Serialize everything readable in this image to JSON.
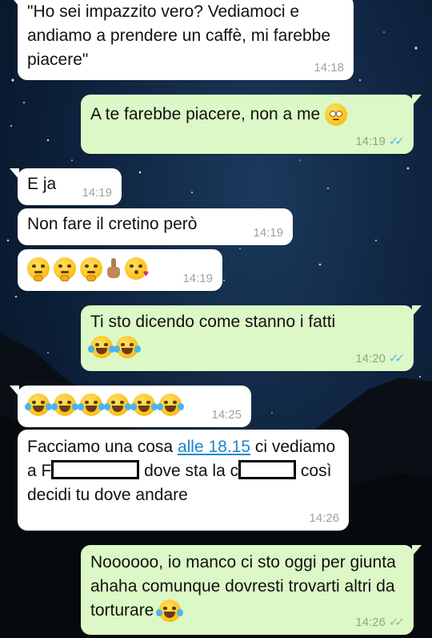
{
  "colors": {
    "incoming": "#ffffff",
    "outgoing": "#dcf8c6",
    "link": "#1a87c9",
    "read_ticks": "#4fb6ec"
  },
  "messages": [
    {
      "from": "them",
      "text": "\"Ho sei impazzito vero? Vediamoci e andiamo a prendere un caffè, mi farebbe piacere\"",
      "time": "14:18"
    },
    {
      "from": "me",
      "text": "A te farebbe piacere, non a me",
      "emoji": [
        "face-with-rolling-eyes"
      ],
      "time": "14:19",
      "status": "read"
    },
    {
      "from": "them",
      "text": "E ja",
      "time": "14:19"
    },
    {
      "from": "them",
      "text": "Non fare il cretino però",
      "time": "14:19"
    },
    {
      "from": "them",
      "emoji": [
        "thinking-face",
        "thinking-face",
        "thinking-face",
        "middle-finger",
        "face-blowing-kiss"
      ],
      "time": "14:19"
    },
    {
      "from": "me",
      "text": "Ti sto dicendo come stanno i fatti",
      "emoji": [
        "face-with-tears-of-joy",
        "face-with-tears-of-joy"
      ],
      "time": "14:20",
      "status": "read"
    },
    {
      "from": "them",
      "emoji": [
        "face-with-tears-of-joy",
        "face-with-tears-of-joy",
        "face-with-tears-of-joy",
        "face-with-tears-of-joy",
        "face-with-tears-of-joy",
        "face-with-tears-of-joy"
      ],
      "time": "14:25"
    },
    {
      "from": "them",
      "text_parts": [
        "Facciamo una cosa ",
        "alle 18.15",
        " ci vediamo a F",
        " dove sta la c",
        " così decidi tu dove andare"
      ],
      "time": "14:26"
    },
    {
      "from": "me",
      "text": "Noooooo, io manco ci sto oggi per giunta ahaha comunque dovresti trovarti altri da torturare",
      "emoji": [
        "face-with-tears-of-joy"
      ],
      "time": "14:26",
      "status": "delivered"
    }
  ],
  "icons": {
    "read": "double-check-blue",
    "delivered": "double-check-grey"
  }
}
